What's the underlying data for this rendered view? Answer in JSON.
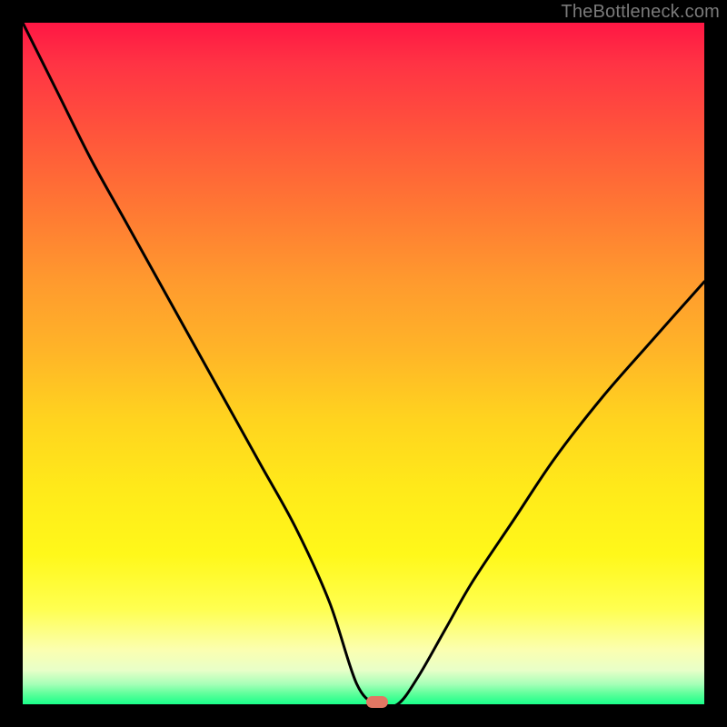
{
  "watermark": "TheBottleneck.com",
  "marker": {
    "x_pct": 52,
    "y_pct": 0
  },
  "chart_data": {
    "type": "line",
    "title": "",
    "xlabel": "",
    "ylabel": "",
    "xlim": [
      0,
      100
    ],
    "ylim": [
      0,
      100
    ],
    "grid": false,
    "legend": false,
    "series": [
      {
        "name": "bottleneck-curve",
        "x": [
          0,
          5,
          10,
          15,
          20,
          25,
          30,
          35,
          40,
          45,
          49,
          52,
          55,
          58,
          62,
          66,
          72,
          78,
          85,
          92,
          100
        ],
        "y": [
          100,
          90,
          80,
          71,
          62,
          53,
          44,
          35,
          26,
          15,
          3,
          0,
          0,
          4,
          11,
          18,
          27,
          36,
          45,
          53,
          62
        ]
      }
    ],
    "marker_point": {
      "x": 52,
      "y": 0,
      "color": "#e27763"
    },
    "background_gradient": {
      "top": "#ff1744",
      "mid": "#ffd31f",
      "bottom": "#1aff8a"
    }
  }
}
